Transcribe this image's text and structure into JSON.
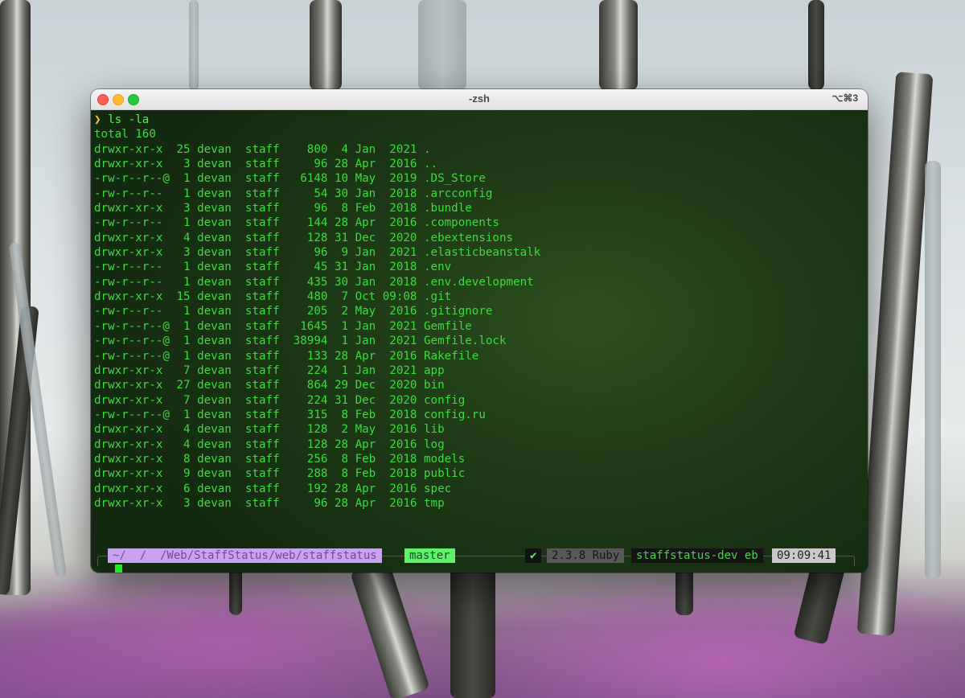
{
  "window": {
    "title": "-zsh",
    "shortcut": "⌥⌘3"
  },
  "terminal": {
    "prompt_symbol": "❯",
    "command": "ls -la",
    "total_line": "total 160",
    "listing": [
      {
        "perms": "drwxr-xr-x ",
        "links": "25",
        "owner": "devan",
        "group": "staff",
        "size": "800",
        "day": "4",
        "month": "Jan",
        "time": "2021",
        "name": "."
      },
      {
        "perms": "drwxr-xr-x ",
        "links": "3",
        "owner": "devan",
        "group": "staff",
        "size": "96",
        "day": "28",
        "month": "Apr",
        "time": "2016",
        "name": ".."
      },
      {
        "perms": "-rw-r--r--@",
        "links": "1",
        "owner": "devan",
        "group": "staff",
        "size": "6148",
        "day": "10",
        "month": "May",
        "time": "2019",
        "name": ".DS_Store"
      },
      {
        "perms": "-rw-r--r-- ",
        "links": "1",
        "owner": "devan",
        "group": "staff",
        "size": "54",
        "day": "30",
        "month": "Jan",
        "time": "2018",
        "name": ".arcconfig"
      },
      {
        "perms": "drwxr-xr-x ",
        "links": "3",
        "owner": "devan",
        "group": "staff",
        "size": "96",
        "day": "8",
        "month": "Feb",
        "time": "2018",
        "name": ".bundle"
      },
      {
        "perms": "-rw-r--r-- ",
        "links": "1",
        "owner": "devan",
        "group": "staff",
        "size": "144",
        "day": "28",
        "month": "Apr",
        "time": "2016",
        "name": ".components"
      },
      {
        "perms": "drwxr-xr-x ",
        "links": "4",
        "owner": "devan",
        "group": "staff",
        "size": "128",
        "day": "31",
        "month": "Dec",
        "time": "2020",
        "name": ".ebextensions"
      },
      {
        "perms": "drwxr-xr-x ",
        "links": "3",
        "owner": "devan",
        "group": "staff",
        "size": "96",
        "day": "9",
        "month": "Jan",
        "time": "2021",
        "name": ".elasticbeanstalk"
      },
      {
        "perms": "-rw-r--r-- ",
        "links": "1",
        "owner": "devan",
        "group": "staff",
        "size": "45",
        "day": "31",
        "month": "Jan",
        "time": "2018",
        "name": ".env"
      },
      {
        "perms": "-rw-r--r-- ",
        "links": "1",
        "owner": "devan",
        "group": "staff",
        "size": "435",
        "day": "30",
        "month": "Jan",
        "time": "2018",
        "name": ".env.development"
      },
      {
        "perms": "drwxr-xr-x ",
        "links": "15",
        "owner": "devan",
        "group": "staff",
        "size": "480",
        "day": "7",
        "month": "Oct",
        "time": "09:08",
        "name": ".git"
      },
      {
        "perms": "-rw-r--r-- ",
        "links": "1",
        "owner": "devan",
        "group": "staff",
        "size": "205",
        "day": "2",
        "month": "May",
        "time": "2016",
        "name": ".gitignore"
      },
      {
        "perms": "-rw-r--r--@",
        "links": "1",
        "owner": "devan",
        "group": "staff",
        "size": "1645",
        "day": "1",
        "month": "Jan",
        "time": "2021",
        "name": "Gemfile"
      },
      {
        "perms": "-rw-r--r--@",
        "links": "1",
        "owner": "devan",
        "group": "staff",
        "size": "38994",
        "day": "1",
        "month": "Jan",
        "time": "2021",
        "name": "Gemfile.lock"
      },
      {
        "perms": "-rw-r--r--@",
        "links": "1",
        "owner": "devan",
        "group": "staff",
        "size": "133",
        "day": "28",
        "month": "Apr",
        "time": "2016",
        "name": "Rakefile"
      },
      {
        "perms": "drwxr-xr-x ",
        "links": "7",
        "owner": "devan",
        "group": "staff",
        "size": "224",
        "day": "1",
        "month": "Jan",
        "time": "2021",
        "name": "app"
      },
      {
        "perms": "drwxr-xr-x ",
        "links": "27",
        "owner": "devan",
        "group": "staff",
        "size": "864",
        "day": "29",
        "month": "Dec",
        "time": "2020",
        "name": "bin"
      },
      {
        "perms": "drwxr-xr-x ",
        "links": "7",
        "owner": "devan",
        "group": "staff",
        "size": "224",
        "day": "31",
        "month": "Dec",
        "time": "2020",
        "name": "config"
      },
      {
        "perms": "-rw-r--r--@",
        "links": "1",
        "owner": "devan",
        "group": "staff",
        "size": "315",
        "day": "8",
        "month": "Feb",
        "time": "2018",
        "name": "config.ru"
      },
      {
        "perms": "drwxr-xr-x ",
        "links": "4",
        "owner": "devan",
        "group": "staff",
        "size": "128",
        "day": "2",
        "month": "May",
        "time": "2016",
        "name": "lib"
      },
      {
        "perms": "drwxr-xr-x ",
        "links": "4",
        "owner": "devan",
        "group": "staff",
        "size": "128",
        "day": "28",
        "month": "Apr",
        "time": "2016",
        "name": "log"
      },
      {
        "perms": "drwxr-xr-x ",
        "links": "8",
        "owner": "devan",
        "group": "staff",
        "size": "256",
        "day": "8",
        "month": "Feb",
        "time": "2018",
        "name": "models"
      },
      {
        "perms": "drwxr-xr-x ",
        "links": "9",
        "owner": "devan",
        "group": "staff",
        "size": "288",
        "day": "8",
        "month": "Feb",
        "time": "2018",
        "name": "public"
      },
      {
        "perms": "drwxr-xr-x ",
        "links": "6",
        "owner": "devan",
        "group": "staff",
        "size": "192",
        "day": "28",
        "month": "Apr",
        "time": "2016",
        "name": "spec"
      },
      {
        "perms": "drwxr-xr-x ",
        "links": "3",
        "owner": "devan",
        "group": "staff",
        "size": "96",
        "day": "28",
        "month": "Apr",
        "time": "2016",
        "name": "tmp"
      }
    ]
  },
  "prompt_bar": {
    "path": "~/  /  /Web/StaffStatus/web/staffstatus",
    "branch": "master",
    "status_icon": "✔",
    "ruby": "2.3.8 Ruby",
    "env": "staffstatus-dev eb",
    "time": "09:09:41"
  },
  "colors": {
    "terminal_text": "#3ddc3d",
    "terminal_bg": "#1f3b17",
    "path_segment": "#c8a3f0",
    "branch_segment": "#5ef26a",
    "cursor": "#1cf01c"
  }
}
